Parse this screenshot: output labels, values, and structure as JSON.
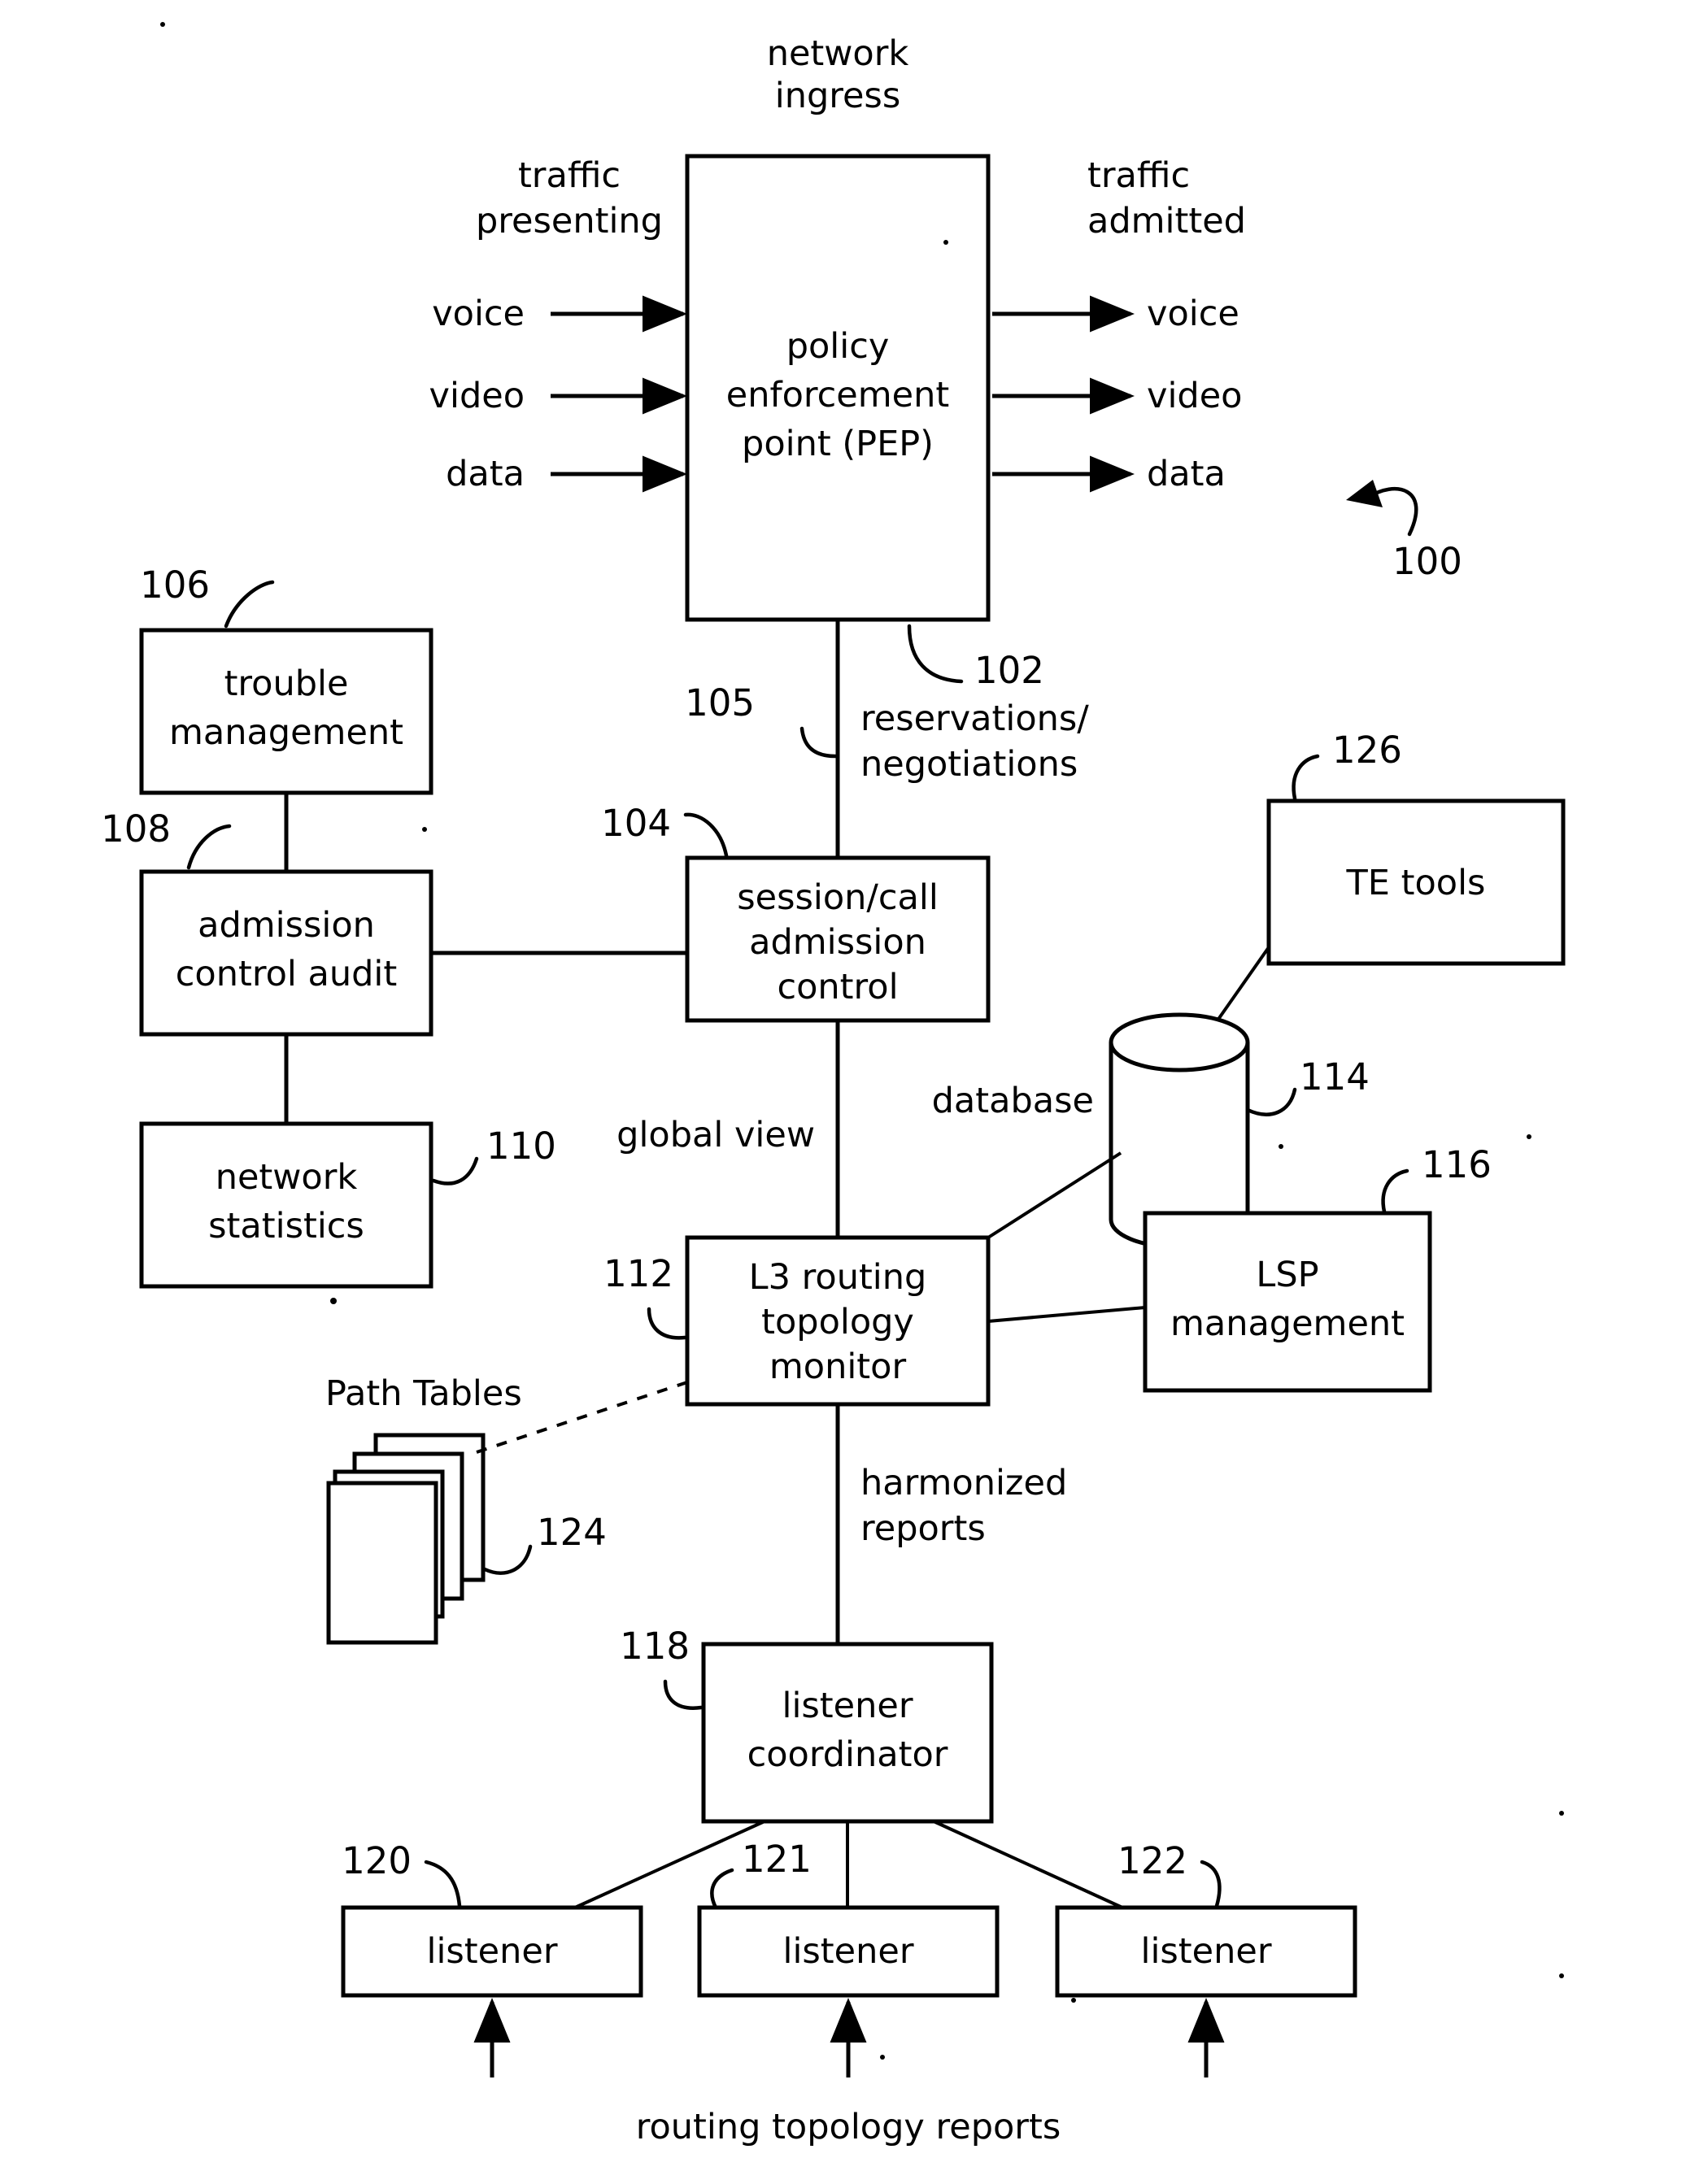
{
  "figure": {
    "reference_numeral": "100",
    "top_label": {
      "line1": "network",
      "line2": "ingress"
    },
    "bottom_caption": "routing topology reports"
  },
  "ingress": {
    "left_heading": {
      "line1": "traffic",
      "line2": "presenting"
    },
    "right_heading": {
      "line1": "traffic",
      "line2": "admitted"
    },
    "inputs": [
      "voice",
      "video",
      "data"
    ],
    "outputs": [
      "voice",
      "video",
      "data"
    ]
  },
  "boxes": {
    "pep": {
      "ref": "102",
      "lines": [
        "policy",
        "enforcement",
        "point (PEP)"
      ]
    },
    "trouble_management": {
      "ref": "106",
      "lines": [
        "trouble",
        "management"
      ]
    },
    "admission_control_audit": {
      "ref": "108",
      "lines": [
        "admission",
        "control audit"
      ]
    },
    "network_statistics": {
      "ref": "110",
      "lines": [
        "network",
        "statistics"
      ]
    },
    "session_call_admission_control": {
      "ref": "104",
      "lines": [
        "session/call",
        "admission",
        "control"
      ]
    },
    "te_tools": {
      "ref": "126",
      "lines": [
        "TE tools"
      ]
    },
    "database": {
      "ref": "114",
      "label": "database"
    },
    "l3_routing_topology_monitor": {
      "ref": "112",
      "lines": [
        "L3 routing",
        "topology",
        "monitor"
      ]
    },
    "lsp_management": {
      "ref": "116",
      "lines": [
        "LSP",
        "management"
      ]
    },
    "path_tables": {
      "ref": "124",
      "label": "Path Tables"
    },
    "listener_coordinator": {
      "ref": "118",
      "lines": [
        "listener",
        "coordinator"
      ]
    },
    "listener_left": {
      "ref": "120",
      "label": "listener"
    },
    "listener_center": {
      "ref": "121",
      "label": "listener"
    },
    "listener_right": {
      "ref": "122",
      "label": "listener"
    }
  },
  "edge_labels": {
    "pep_to_cac": {
      "ref": "105",
      "lines": [
        "reservations/",
        "negotiations"
      ]
    },
    "cac_to_l3": {
      "label": "global view"
    },
    "l3_to_listener_coordinator": {
      "lines": [
        "harmonized",
        "reports"
      ]
    }
  }
}
